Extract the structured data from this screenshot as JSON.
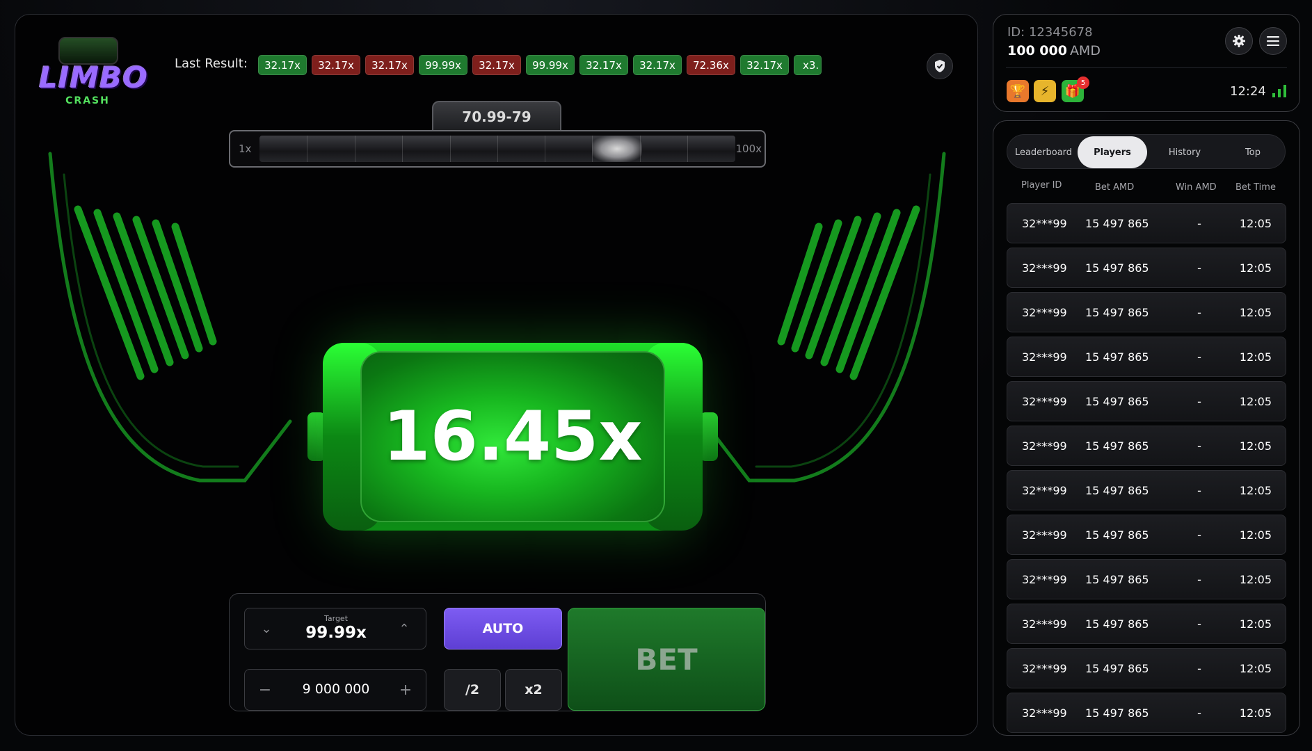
{
  "game": {
    "logo_text": "LIMBO",
    "logo_sub": "CRASH",
    "last_result_label": "Last Result:",
    "results": [
      {
        "value": "32.17x",
        "color": "green"
      },
      {
        "value": "32.17x",
        "color": "red"
      },
      {
        "value": "32.17x",
        "color": "red"
      },
      {
        "value": "99.99x",
        "color": "green"
      },
      {
        "value": "32.17x",
        "color": "red"
      },
      {
        "value": "99.99x",
        "color": "green"
      },
      {
        "value": "32.17x",
        "color": "green"
      },
      {
        "value": "32.17x",
        "color": "green"
      },
      {
        "value": "72.36x",
        "color": "red"
      },
      {
        "value": "32.17x",
        "color": "green"
      },
      {
        "value": "x3.",
        "color": "green"
      }
    ],
    "range_label": "70.99-79",
    "range_min": "1x",
    "range_max": "100x",
    "multiplier": "16.45x",
    "target_label": "Target",
    "target_value": "99.99x",
    "amount_value": "9 000 000",
    "minus_label": "−",
    "plus_label": "+",
    "auto_label": "AUTO",
    "half_label": "/2",
    "double_label": "x2",
    "bet_label": "BET"
  },
  "user": {
    "id": "ID: 12345678",
    "balance": "100 000",
    "currency": "AMD",
    "gift_count": "5",
    "time": "12:24"
  },
  "players": {
    "tabs": [
      "Leaderboard",
      "Players",
      "History",
      "Top"
    ],
    "active_tab": "Players",
    "columns": [
      "Player ID",
      "Bet AMD",
      "Win AMD",
      "Bet Time"
    ],
    "rows": [
      {
        "id": "32***99",
        "bet": "15 497 865",
        "win": "-",
        "time": "12:05"
      },
      {
        "id": "32***99",
        "bet": "15 497 865",
        "win": "-",
        "time": "12:05"
      },
      {
        "id": "32***99",
        "bet": "15 497 865",
        "win": "-",
        "time": "12:05"
      },
      {
        "id": "32***99",
        "bet": "15 497 865",
        "win": "-",
        "time": "12:05"
      },
      {
        "id": "32***99",
        "bet": "15 497 865",
        "win": "-",
        "time": "12:05"
      },
      {
        "id": "32***99",
        "bet": "15 497 865",
        "win": "-",
        "time": "12:05"
      },
      {
        "id": "32***99",
        "bet": "15 497 865",
        "win": "-",
        "time": "12:05"
      },
      {
        "id": "32***99",
        "bet": "15 497 865",
        "win": "-",
        "time": "12:05"
      },
      {
        "id": "32***99",
        "bet": "15 497 865",
        "win": "-",
        "time": "12:05"
      },
      {
        "id": "32***99",
        "bet": "15 497 865",
        "win": "-",
        "time": "12:05"
      },
      {
        "id": "32***99",
        "bet": "15 497 865",
        "win": "-",
        "time": "12:05"
      },
      {
        "id": "32***99",
        "bet": "15 497 865",
        "win": "-",
        "time": "12:05"
      }
    ]
  },
  "icons": {
    "shield": "shield-icon",
    "settings": "gear-icon",
    "menu": "menu-icon",
    "trophy": "trophy-icon",
    "bolt": "lightning-icon",
    "gift": "gift-icon",
    "signal": "signal-icon"
  },
  "colors": {
    "accent_green": "#1f7a2f",
    "accent_red": "#7e1f1c",
    "auto_purple": "#6b4ae0",
    "battery_green": "#1fdf2a"
  }
}
